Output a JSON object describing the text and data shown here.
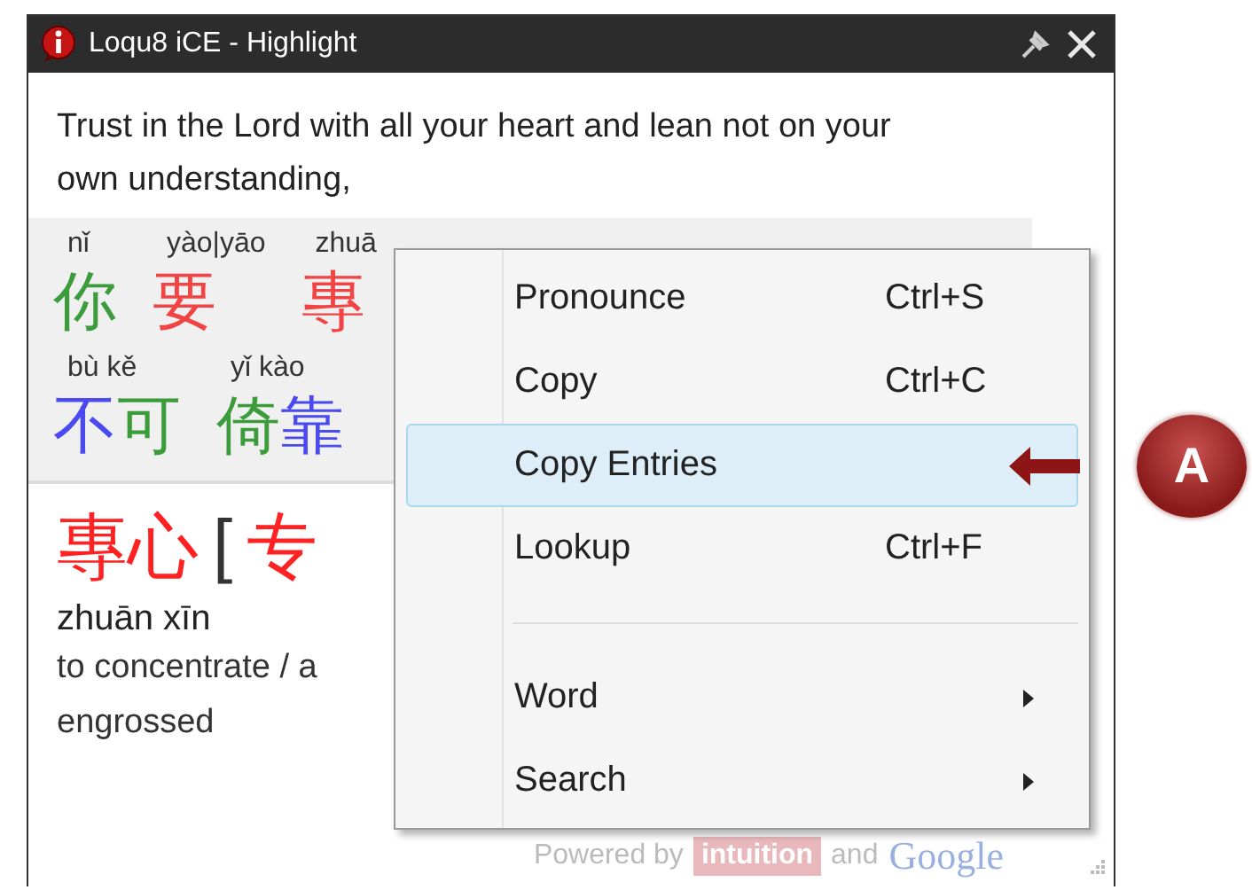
{
  "window": {
    "title": "Loqu8 iCE - Highlight"
  },
  "sentence": "Trust in the Lord with all your heart and lean not on your own understanding,",
  "word_rows": [
    [
      {
        "pinyin": "nǐ",
        "chars": [
          {
            "text": "你",
            "color": "#3c9c3c"
          }
        ]
      },
      {
        "pinyin": "yào|yāo",
        "chars": [
          {
            "text": "要",
            "color": "#f24444"
          }
        ]
      },
      {
        "pinyin": "zhuā",
        "chars": [
          {
            "text": "專",
            "color": "#f24444"
          }
        ]
      }
    ],
    [
      {
        "pinyin": "bù kě",
        "chars": [
          {
            "text": "不",
            "color": "#4a4af0"
          },
          {
            "text": "可",
            "color": "#3c9c3c"
          }
        ]
      },
      {
        "pinyin": "yǐ kào",
        "chars": [
          {
            "text": "倚",
            "color": "#3c9c3c"
          },
          {
            "text": "靠",
            "color": "#4a4af0"
          }
        ]
      }
    ]
  ],
  "entry": {
    "traditional": "專心",
    "bracket": "[",
    "simplified": "专",
    "pinyin": "zhuān xīn",
    "definition_lines": [
      "to concentrate / a",
      "engrossed"
    ]
  },
  "footer": {
    "powered_by": "Powered by",
    "intuition": "intuition",
    "and": "and",
    "google": "Google"
  },
  "context_menu": [
    {
      "kind": "item",
      "label": "Pronounce",
      "shortcut": "Ctrl+S",
      "selected": false
    },
    {
      "kind": "item",
      "label": "Copy",
      "shortcut": "Ctrl+C",
      "selected": false
    },
    {
      "kind": "item",
      "label": "Copy Entries",
      "selected": true
    },
    {
      "kind": "item",
      "label": "Lookup",
      "shortcut": "Ctrl+F",
      "selected": false
    },
    {
      "kind": "separator"
    },
    {
      "kind": "submenu",
      "label": "Word",
      "selected": false
    },
    {
      "kind": "submenu",
      "label": "Search",
      "selected": false
    }
  ],
  "callout": {
    "label": "A"
  }
}
